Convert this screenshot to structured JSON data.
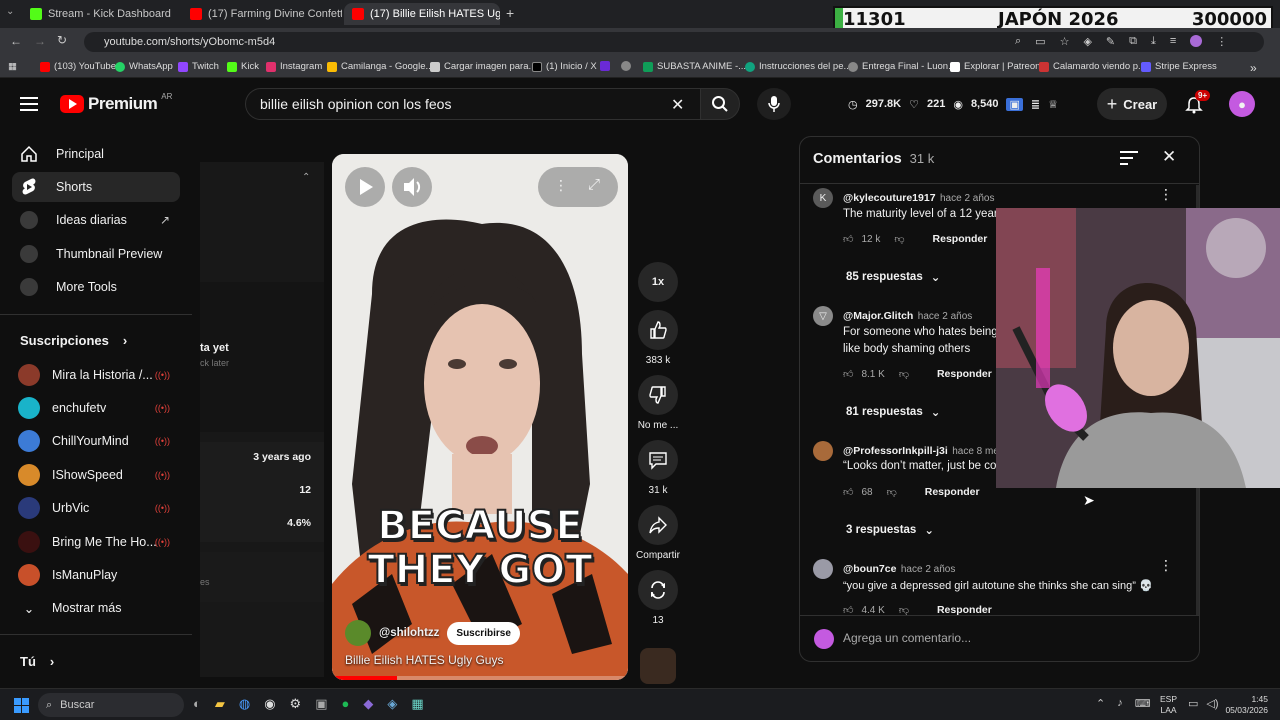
{
  "browser": {
    "tabs": [
      {
        "title": "Stream - Kick Dashboard",
        "color": "#53fc18"
      },
      {
        "title": "(17) Farming Divine Confetti Th",
        "color": "#ff0000"
      },
      {
        "title": "(17) Billie Eilish HATES Ugly Gu",
        "color": "#ff0000"
      }
    ],
    "url": "youtube.com/shorts/yObomc-m5d4",
    "bookmarks": [
      "(103) YouTube",
      "WhatsApp",
      "Twitch",
      "Kick",
      "Instagram",
      "Camilanga - Google...",
      "Cargar imagen para...",
      "(1) Inicio / X",
      "",
      "SUBASTA ANIME -...",
      "Instrucciones del pe...",
      "Entrega Final - Luon...",
      "Explorar | Patreon",
      "Calamardo viendo p...",
      "Stripe Express"
    ]
  },
  "overlay": {
    "left": "11301",
    "center": "JAPÓN 2026",
    "right": "300000"
  },
  "youtube": {
    "logo": "Premium",
    "region": "AR",
    "search_query": "billie eilish opinion con los feos",
    "stats": [
      "297.8K",
      "221",
      "8,540"
    ],
    "create_label": "Crear",
    "notif_count": "9+"
  },
  "sidebar": {
    "items": [
      "Principal",
      "Shorts",
      "Ideas diarias",
      "Thumbnail Preview",
      "More Tools"
    ],
    "subs_header": "Suscripciones",
    "subs": [
      "Mira la Historia /...",
      "enchufetv",
      "ChillYourMind",
      "IShowSpeed",
      "UrbVic",
      "Bring Me The Ho...",
      "IsManuPlay"
    ],
    "more": "Mostrar más",
    "you": "Tú"
  },
  "leftpanel": {
    "t1": "ta yet",
    "t2": "ck later",
    "age": "3 years ago",
    "n1": "12",
    "pct": "4.6%",
    "s": "es"
  },
  "video": {
    "caption": [
      "BECAUSE",
      "THEY GOT"
    ],
    "channel": "@shilohtzz",
    "subscribe": "Suscribirse",
    "title": "Billie Eilish HATES Ugly Guys"
  },
  "actions": {
    "speed": "1x",
    "likes": "383 k",
    "dislike": "No me ...",
    "comments": "31 k",
    "share": "Compartir",
    "remix": "13"
  },
  "comments": {
    "title": "Comentarios",
    "count": "31 k",
    "reply_label": "Responder",
    "add_placeholder": "Agrega un comentario...",
    "list": [
      {
        "user": "@kylecouture1917",
        "time": "hace 2 años",
        "text": "The maturity level of a 12 year",
        "likes": "12 k",
        "replies": "85 respuestas"
      },
      {
        "user": "@Major.Glitch",
        "time": "hace 2 años",
        "text": "For someone who hates being",
        "text2": "like body shaming others",
        "likes": "8.1 K",
        "replies": "81 respuestas"
      },
      {
        "user": "@ProfessorInkpill-j3i",
        "time": "hace 8 mes",
        "text": "“Looks don’t matter, just be co",
        "likes": "68",
        "replies": "3 respuestas"
      },
      {
        "user": "@boun7ce",
        "time": "hace 2 años",
        "text": "“you give a depressed girl autotune she thinks she can sing” 💀",
        "likes": "4.4 K"
      }
    ]
  },
  "taskbar": {
    "search": "Buscar",
    "lang1": "ESP",
    "lang2": "LAA",
    "time": "1:45",
    "date": "05/03/2026"
  }
}
